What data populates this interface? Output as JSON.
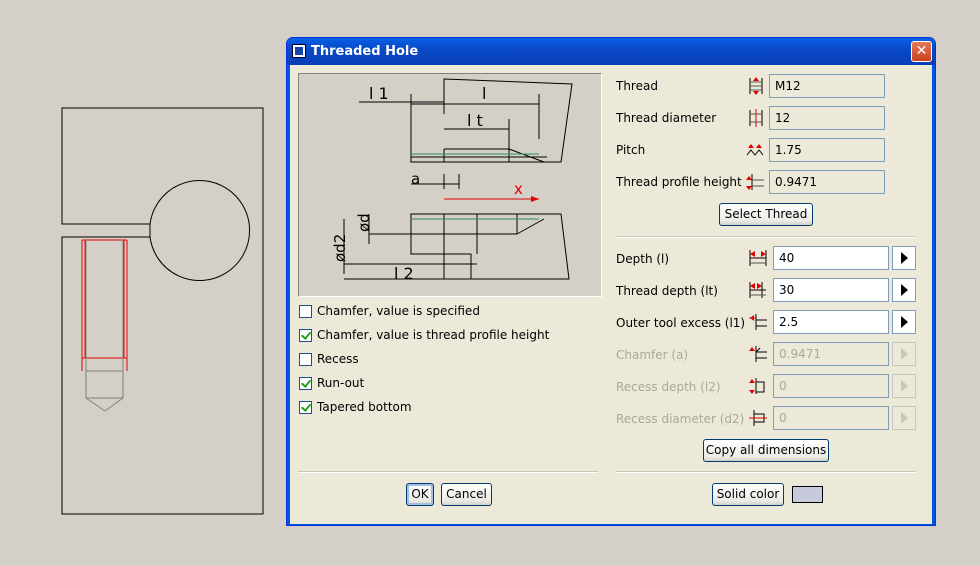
{
  "window": {
    "title": "Threaded Hole",
    "close_symbol": "✕"
  },
  "checkboxes": [
    {
      "label": "Chamfer, value is specified",
      "checked": false
    },
    {
      "label": "Chamfer, value is thread profile height",
      "checked": true
    },
    {
      "label": "Recess",
      "checked": false
    },
    {
      "label": "Run-out",
      "checked": true
    },
    {
      "label": "Tapered bottom",
      "checked": true
    }
  ],
  "thread_info": {
    "thread": {
      "label": "Thread",
      "value": "M12",
      "icon": "thread-icon"
    },
    "diameter": {
      "label": "Thread diameter",
      "value": "12",
      "icon": "diameter-icon"
    },
    "pitch": {
      "label": "Pitch",
      "value": "1.75",
      "icon": "pitch-icon"
    },
    "profile_height": {
      "label": "Thread profile height",
      "value": "0.9471",
      "icon": "profile-height-icon"
    }
  },
  "buttons": {
    "select_thread": "Select Thread",
    "copy_all": "Copy all dimensions",
    "ok": "OK",
    "cancel": "Cancel",
    "solid_color": "Solid color"
  },
  "dimensions": [
    {
      "key": "depth",
      "label": "Depth (l)",
      "value": "40",
      "enabled": true
    },
    {
      "key": "thread_depth",
      "label": "Thread depth (lt)",
      "value": "30",
      "enabled": true
    },
    {
      "key": "outer_excess",
      "label": "Outer tool excess (l1)",
      "value": "2.5",
      "enabled": true
    },
    {
      "key": "chamfer",
      "label": "Chamfer (a)",
      "value": "0.9471",
      "enabled": false
    },
    {
      "key": "recess_depth",
      "label": "Recess depth (l2)",
      "value": "0",
      "enabled": false
    },
    {
      "key": "recess_diameter",
      "label": "Recess diameter (d2)",
      "value": "0",
      "enabled": false
    }
  ],
  "preview_labels": {
    "l1": "l 1",
    "l": "l",
    "lt": "l t",
    "a": "a",
    "x": "x",
    "d": "ød",
    "d2": "ød2",
    "l2": "l 2"
  },
  "colors": {
    "solid_color": "#c6cadb",
    "accent_red": "#e00000",
    "title_blue": "#0a5fe6"
  }
}
